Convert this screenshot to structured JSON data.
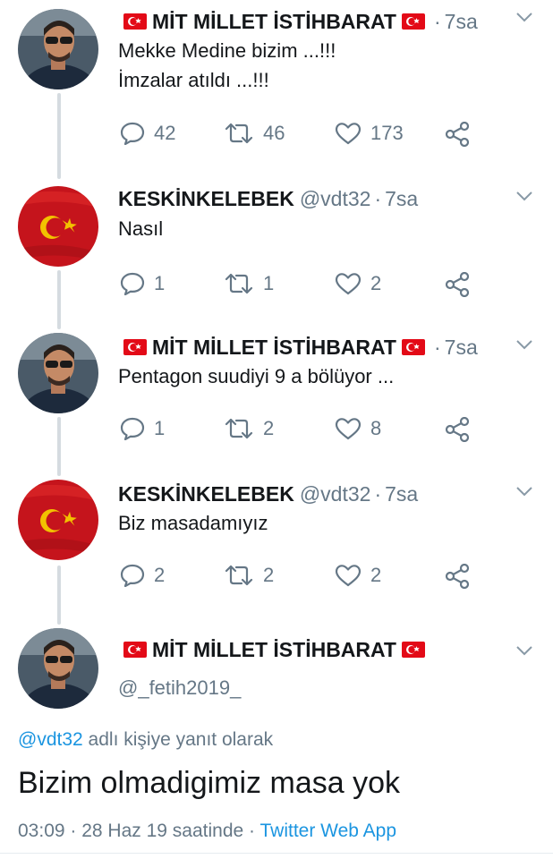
{
  "tweets": [
    {
      "display_name": "MİT MİLLET İSTİHBARAT",
      "flags": true,
      "handle": "",
      "time": "7sa",
      "avatar": "man-sunglasses",
      "lines": [
        "Mekke Medine bizim ...!!!",
        "İmzalar atıldı ...!!!"
      ],
      "replies": "42",
      "retweets": "46",
      "likes": "173"
    },
    {
      "display_name": "KESKİNKELEBEK",
      "flags": false,
      "handle": "@vdt32",
      "time": "7sa",
      "avatar": "turkish-flag",
      "lines": [
        "Nasıl"
      ],
      "replies": "1",
      "retweets": "1",
      "likes": "2"
    },
    {
      "display_name": "MİT MİLLET İSTİHBARAT",
      "flags": true,
      "handle": "",
      "time": "7sa",
      "avatar": "man-sunglasses",
      "lines": [
        "Pentagon suudiyi 9 a bölüyor ..."
      ],
      "replies": "1",
      "retweets": "2",
      "likes": "8"
    },
    {
      "display_name": "KESKİNKELEBEK",
      "flags": false,
      "handle": "@vdt32",
      "time": "7sa",
      "avatar": "turkish-flag",
      "lines": [
        "Biz masadamıyız"
      ],
      "replies": "2",
      "retweets": "2",
      "likes": "2"
    }
  ],
  "main_tweet": {
    "display_name": "MİT MİLLET İSTİHBARAT",
    "handle": "@_fetih2019_",
    "reply_mention": "@vdt32",
    "reply_suffix": "adlı kişiye yanıt olarak",
    "text": "Bizim olmadigimiz masa yok",
    "timestamp": "03:09 · 28 Haz 19 saatinde",
    "meta_sep": " · ",
    "client": "Twitter Web App"
  },
  "colors": {
    "secondary_text": "#657786",
    "link": "#1b95e0",
    "flag_red": "#e30a17",
    "thread_line": "#d5dbe0"
  },
  "icons": [
    "reply-icon",
    "retweet-icon",
    "like-icon",
    "share-icon",
    "caret-down-icon",
    "turkish-flag-icon"
  ]
}
